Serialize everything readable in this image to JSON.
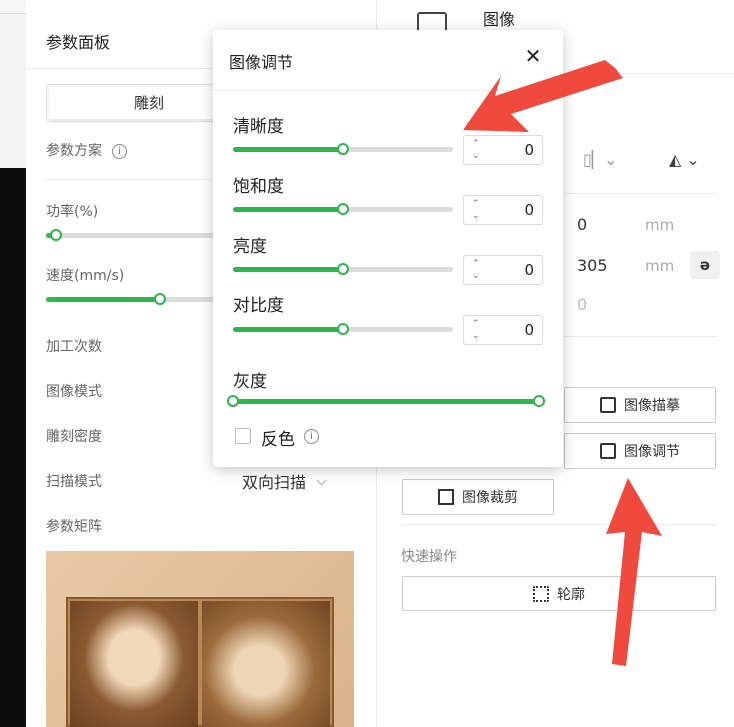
{
  "param_panel": {
    "title": "参数面板",
    "tab_active": "雕刻",
    "scheme_label": "参数方案",
    "power_label": "功率(%)",
    "speed_label": "速度(mm/s)",
    "passes_label": "加工次数",
    "image_mode_label": "图像模式",
    "density_label": "雕刻密度",
    "scan_mode_label": "扫描模式",
    "scan_mode_value": "双向扫描",
    "matrix_label": "参数矩阵",
    "power_level": 0.05,
    "speed_level": 0.6
  },
  "right_panel": {
    "title": "图像",
    "x_value": "0",
    "y_value": "305",
    "unit_mm": "mm",
    "rotation_value": "0",
    "link_icon_glyph": "ə",
    "trace_button": "图像描摹",
    "adjust_button": "图像调节",
    "crop_button": "图像裁剪",
    "quick_ops_label": "快速操作",
    "outline_button": "轮廓"
  },
  "popup": {
    "title": "图像调节",
    "close_glyph": "✕",
    "sliders": [
      {
        "label": "清晰度",
        "value": "0",
        "level": 0.5
      },
      {
        "label": "饱和度",
        "value": "0",
        "level": 0.5
      },
      {
        "label": "亮度",
        "value": "0",
        "level": 0.5
      },
      {
        "label": "对比度",
        "value": "0",
        "level": 0.5
      }
    ],
    "gray_label": "灰度",
    "gray_range": [
      0,
      1
    ],
    "invert_label": "反色",
    "invert_checked": false
  },
  "colors": {
    "accent": "#2cb64c",
    "annotation_arrow": "#f04a3e"
  }
}
